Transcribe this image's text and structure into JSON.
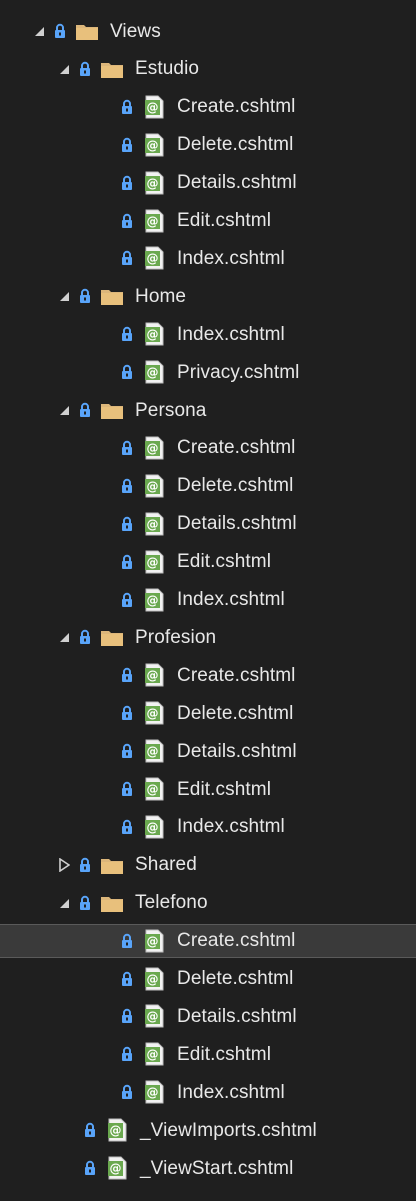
{
  "tree": {
    "items": [
      {
        "label": "Views",
        "type": "folder",
        "level": 0,
        "expanded": true
      },
      {
        "label": "Estudio",
        "type": "folder",
        "level": 1,
        "expanded": true
      },
      {
        "label": "Create.cshtml",
        "type": "file",
        "level": 2
      },
      {
        "label": "Delete.cshtml",
        "type": "file",
        "level": 2
      },
      {
        "label": "Details.cshtml",
        "type": "file",
        "level": 2
      },
      {
        "label": "Edit.cshtml",
        "type": "file",
        "level": 2
      },
      {
        "label": "Index.cshtml",
        "type": "file",
        "level": 2
      },
      {
        "label": "Home",
        "type": "folder",
        "level": 1,
        "expanded": true
      },
      {
        "label": "Index.cshtml",
        "type": "file",
        "level": 2
      },
      {
        "label": "Privacy.cshtml",
        "type": "file",
        "level": 2
      },
      {
        "label": "Persona",
        "type": "folder",
        "level": 1,
        "expanded": true
      },
      {
        "label": "Create.cshtml",
        "type": "file",
        "level": 2
      },
      {
        "label": "Delete.cshtml",
        "type": "file",
        "level": 2
      },
      {
        "label": "Details.cshtml",
        "type": "file",
        "level": 2
      },
      {
        "label": "Edit.cshtml",
        "type": "file",
        "level": 2
      },
      {
        "label": "Index.cshtml",
        "type": "file",
        "level": 2
      },
      {
        "label": "Profesion",
        "type": "folder",
        "level": 1,
        "expanded": true
      },
      {
        "label": "Create.cshtml",
        "type": "file",
        "level": 2
      },
      {
        "label": "Delete.cshtml",
        "type": "file",
        "level": 2
      },
      {
        "label": "Details.cshtml",
        "type": "file",
        "level": 2
      },
      {
        "label": "Edit.cshtml",
        "type": "file",
        "level": 2
      },
      {
        "label": "Index.cshtml",
        "type": "file",
        "level": 2
      },
      {
        "label": "Shared",
        "type": "folder",
        "level": 1,
        "expanded": false
      },
      {
        "label": "Telefono",
        "type": "folder",
        "level": 1,
        "expanded": true
      },
      {
        "label": "Create.cshtml",
        "type": "file",
        "level": 2,
        "selected": true
      },
      {
        "label": "Delete.cshtml",
        "type": "file",
        "level": 2
      },
      {
        "label": "Details.cshtml",
        "type": "file",
        "level": 2
      },
      {
        "label": "Edit.cshtml",
        "type": "file",
        "level": 2
      },
      {
        "label": "Index.cshtml",
        "type": "file",
        "level": 2
      },
      {
        "label": "_ViewImports.cshtml",
        "type": "file",
        "level": 1
      },
      {
        "label": "_ViewStart.cshtml",
        "type": "file",
        "level": 1
      }
    ],
    "colors": {
      "background": "#1f1f1f",
      "selected_background": "#3a3a3a",
      "folder": "#dcb67a",
      "lock": "#59a4f9",
      "razor_file": "#6aa84f",
      "text": "#e8e8e8"
    },
    "icons": {
      "expanded": "expanded-triangle-icon",
      "collapsed": "collapsed-triangle-icon",
      "lock": "lock-icon",
      "folder": "folder-icon",
      "file": "razor-file-icon"
    }
  }
}
